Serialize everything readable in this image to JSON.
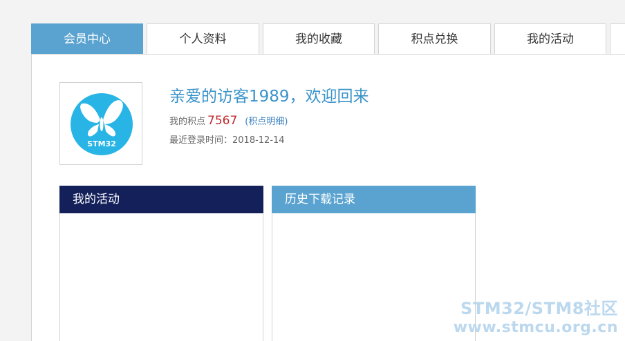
{
  "tabs": [
    {
      "label": "会员中心",
      "active": true
    },
    {
      "label": "个人资料",
      "active": false
    },
    {
      "label": "我的收藏",
      "active": false
    },
    {
      "label": "积点兑换",
      "active": false
    },
    {
      "label": "我的活动",
      "active": false
    }
  ],
  "profile": {
    "avatar_text": "STM32",
    "welcome": "亲爱的访客1989，欢迎回来",
    "points_label": "我的积点",
    "points_value": "7567",
    "points_detail_link": "(积点明细)",
    "last_login": "最近登录时间：2018-12-14"
  },
  "boxes": {
    "activity_title": "我的活动",
    "downloads_title": "历史下载记录"
  },
  "watermark": {
    "line1": "STM32/STM8社区",
    "line2": "www.stmcu.org.cn"
  },
  "colors": {
    "tab_active": "#5aa3d0",
    "welcome_text": "#3a93c9",
    "points_value": "#c0282d",
    "activity_header": "#13205a",
    "downloads_header": "#5aa3d0",
    "logo_circle": "#28b5e6"
  }
}
